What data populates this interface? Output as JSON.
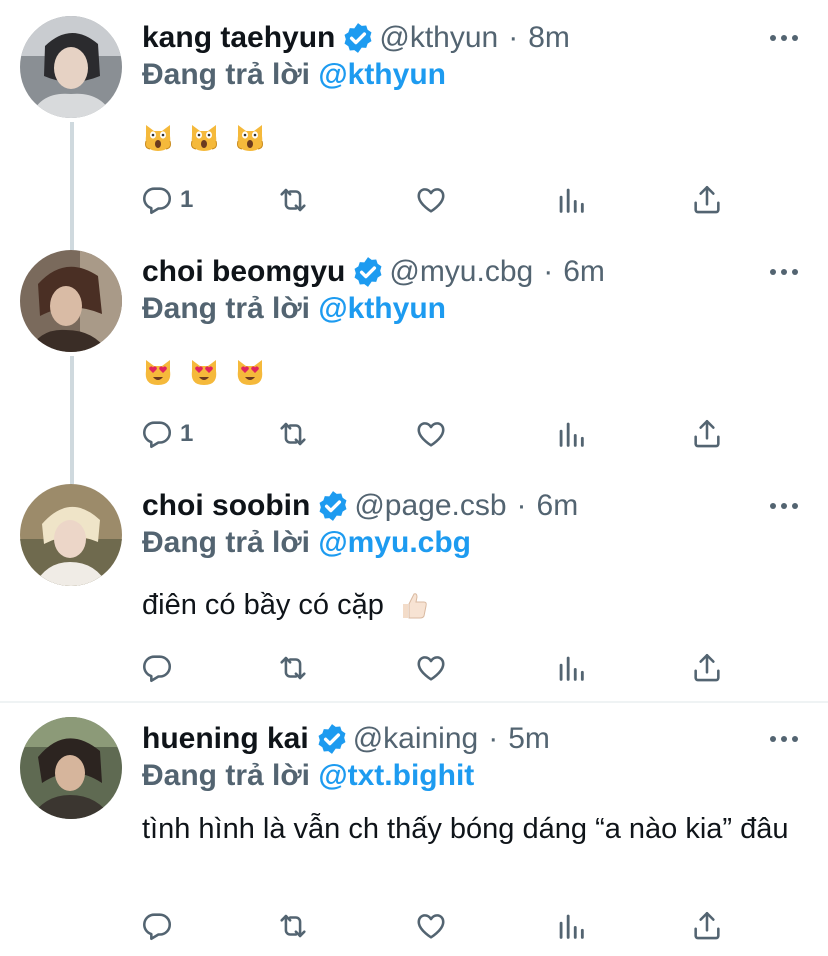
{
  "tweets": [
    {
      "name": "kang taehyun",
      "handle": "@kthyun",
      "time": "8m",
      "reply_prefix": "Đang trả lời",
      "reply_to": "@kthyun",
      "text": "",
      "emoji": [
        "scream-cat",
        "scream-cat",
        "scream-cat"
      ],
      "reply_count": "1"
    },
    {
      "name": "choi beomgyu",
      "handle": "@myu.cbg",
      "time": "6m",
      "reply_prefix": "Đang trả lời",
      "reply_to": "@kthyun",
      "text": "",
      "emoji": [
        "heart-eyes-cat",
        "heart-eyes-cat",
        "heart-eyes-cat"
      ],
      "reply_count": "1"
    },
    {
      "name": "choi soobin",
      "handle": "@page.csb",
      "time": "6m",
      "reply_prefix": "Đang trả lời",
      "reply_to": "@myu.cbg",
      "text": "điên có bầy có cặp",
      "emoji": [
        "thumbs-up"
      ],
      "reply_count": ""
    },
    {
      "name": "huening kai",
      "handle": "@kaining",
      "time": "5m",
      "reply_prefix": "Đang trả lời",
      "reply_to": "@txt.bighit",
      "text": "tình hình là vẫn ch thấy bóng dáng “a nào kia” đâu",
      "emoji": [],
      "reply_count": ""
    }
  ],
  "separator": "·",
  "colors": {
    "accent": "#1d9bf0",
    "muted": "#536471",
    "text": "#0f1419",
    "thread_line": "#cfd9de"
  }
}
